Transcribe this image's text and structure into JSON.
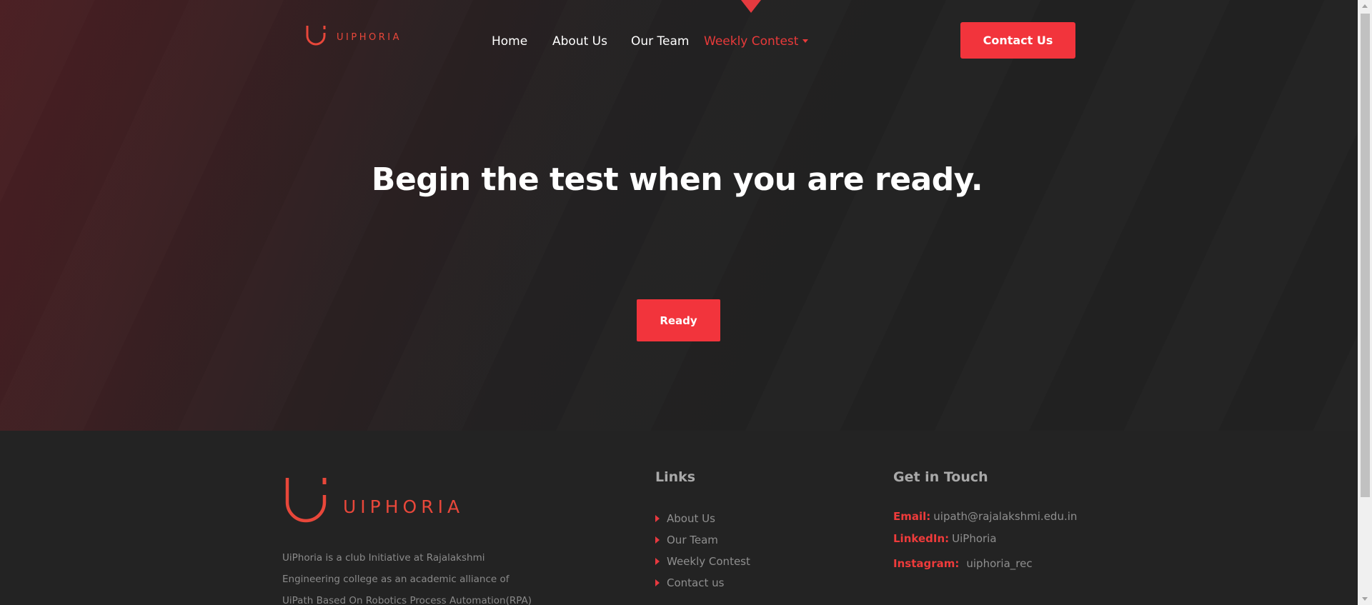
{
  "header": {
    "logo_text": "UIPHORIA",
    "nav": [
      {
        "label": "Home"
      },
      {
        "label": "About Us"
      },
      {
        "label": "Our Team"
      },
      {
        "label": "Weekly Contest",
        "active": true
      }
    ],
    "contact_button": "Contact Us"
  },
  "hero": {
    "headline": "Begin the test when you are ready.",
    "ready_button": "Ready"
  },
  "footer": {
    "logo_text": "UIPHORIA",
    "about": "UiPhoria is a club Initiative at Rajalakshmi Engineering college as an academic alliance of UiPath Based On Robotics Process Automation(RPA) that focuses on",
    "links_title": "Links",
    "links": [
      "About Us",
      "Our Team",
      "Weekly Contest",
      "Contact us"
    ],
    "contact_title": "Get in Touch",
    "email_label": "Email:",
    "email": "uipath@rajalakshmi.edu.in",
    "linkedin_label": "LinkedIn:",
    "linkedin": "UiPhoria",
    "instagram_label": "Instagram:",
    "instagram": "uiphoria_rec"
  },
  "colors": {
    "accent": "#f2343c",
    "background": "#232323",
    "logo": "#e8473a"
  }
}
